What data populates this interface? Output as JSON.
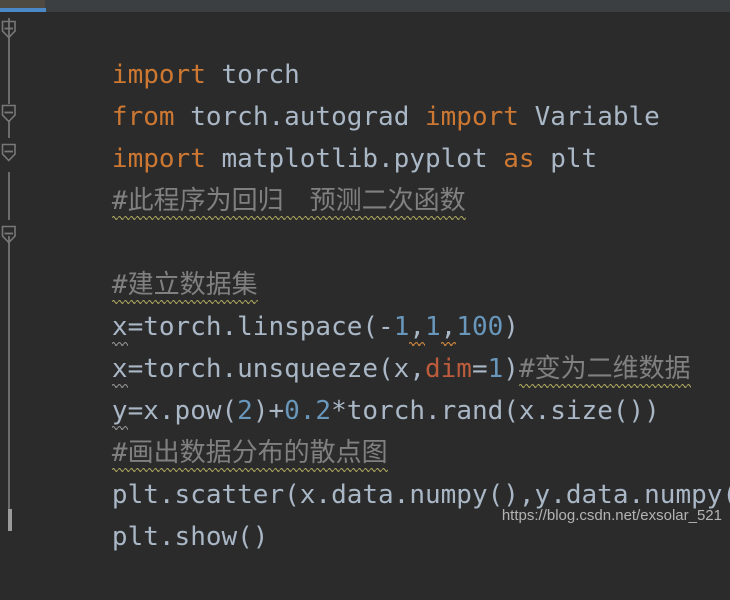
{
  "window": {
    "theme": "darcula-dark",
    "background_color": "#2b2b2b",
    "tab_bar_color": "#3c3f41"
  },
  "tab_bar": {
    "active_tab_color": "#4e4a42",
    "active_tab_underline_color": "#4a88c7"
  },
  "gutter": {
    "rail_color": "#6c6c6c",
    "fold_marker_color": "#787878",
    "fold_markers": [
      {
        "name": "fold-marker-import-block",
        "line": 1,
        "state": "expanded"
      },
      {
        "name": "fold-marker-import-matplotlib",
        "line": 3,
        "state": "expanded"
      },
      {
        "name": "fold-marker-comment-block",
        "line": 4,
        "state": "expanded"
      },
      {
        "name": "fold-marker-dataset-block",
        "line": 6,
        "state": "expanded"
      }
    ]
  },
  "syntax_colors": {
    "keyword": "#cc7832",
    "identifier": "#a9b7c6",
    "number": "#6897bb",
    "named_argument": "#bc5c3c",
    "comment": "#808080",
    "squiggle_spelling": "#a9a15c",
    "squiggle_weak_warning": "#8a8a8a",
    "squiggle_warning": "#c9833a"
  },
  "code": {
    "language": "python",
    "lines": [
      {
        "n": 1,
        "text": "import torch",
        "tokens": [
          {
            "t": "import",
            "c": "kw"
          },
          {
            "t": " torch",
            "c": "id"
          }
        ]
      },
      {
        "n": 2,
        "text": "from torch.autograd import Variable",
        "tokens": [
          {
            "t": "from",
            "c": "kw"
          },
          {
            "t": " torch.autograd ",
            "c": "id"
          },
          {
            "t": "import",
            "c": "kw"
          },
          {
            "t": " Variable",
            "c": "id"
          }
        ]
      },
      {
        "n": 3,
        "text": "import matplotlib.pyplot as plt",
        "tokens": [
          {
            "t": "import",
            "c": "kw"
          },
          {
            "t": " matplotlib.pyplot ",
            "c": "id"
          },
          {
            "t": "as",
            "c": "kw"
          },
          {
            "t": " plt",
            "c": "id"
          }
        ]
      },
      {
        "n": 4,
        "text": "#此程序为回归　预测二次函数",
        "tokens": [
          {
            "t": "#此程序为回归　预测二次函数",
            "c": "cmt"
          }
        ]
      },
      {
        "n": 5,
        "text": "",
        "tokens": []
      },
      {
        "n": 6,
        "text": "#建立数据集",
        "tokens": [
          {
            "t": "#建立数据集",
            "c": "cmt"
          }
        ]
      },
      {
        "n": 7,
        "text": "x=torch.linspace(-1,1,100)",
        "tokens": [
          {
            "t": "x",
            "c": "id"
          },
          {
            "t": "=torch.linspace(-",
            "c": "id"
          },
          {
            "t": "1",
            "c": "num"
          },
          {
            "t": ",",
            "c": "id"
          },
          {
            "t": "1",
            "c": "num"
          },
          {
            "t": ",",
            "c": "id"
          },
          {
            "t": "100",
            "c": "num"
          },
          {
            "t": ")",
            "c": "id"
          }
        ]
      },
      {
        "n": 8,
        "text": "x=torch.unsqueeze(x,dim=1)#变为二维数据",
        "tokens": [
          {
            "t": "x",
            "c": "id"
          },
          {
            "t": "=torch.unsqueeze(x,",
            "c": "id"
          },
          {
            "t": "dim",
            "c": "kwarg"
          },
          {
            "t": "=",
            "c": "id"
          },
          {
            "t": "1",
            "c": "num"
          },
          {
            "t": ")",
            "c": "id"
          },
          {
            "t": "#变为二维数据",
            "c": "cmt"
          }
        ]
      },
      {
        "n": 9,
        "text": "y=x.pow(2)+0.2*torch.rand(x.size())",
        "tokens": [
          {
            "t": "y",
            "c": "id"
          },
          {
            "t": "=x.pow(",
            "c": "id"
          },
          {
            "t": "2",
            "c": "num"
          },
          {
            "t": ")+",
            "c": "id"
          },
          {
            "t": "0.2",
            "c": "num"
          },
          {
            "t": "*torch.rand(x.size())",
            "c": "id"
          }
        ]
      },
      {
        "n": 10,
        "text": "#画出数据分布的散点图",
        "tokens": [
          {
            "t": "#画出数据分布的散点图",
            "c": "cmt"
          }
        ]
      },
      {
        "n": 11,
        "text": "plt.scatter(x.data.numpy(),y.data.numpy())",
        "tokens": [
          {
            "t": "plt.scatter(x.data.numpy(),y.data.numpy())",
            "c": "id"
          }
        ]
      },
      {
        "n": 12,
        "text": "plt.show()",
        "tokens": [
          {
            "t": "plt.show()",
            "c": "id"
          }
        ]
      }
    ]
  },
  "watermark": {
    "text": "https://blog.csdn.net/exsolar_521"
  }
}
